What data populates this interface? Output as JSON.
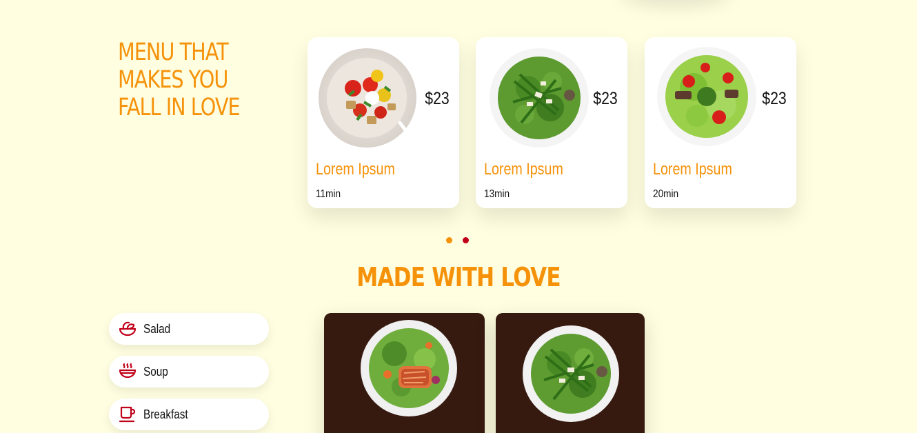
{
  "menu_section": {
    "title": "MENU THAT MAKES YOU FALL IN LOVE",
    "cards": [
      {
        "name": "Lorem Ipsum",
        "price": "$23",
        "time": "11min",
        "image": "tomato-salad-plate"
      },
      {
        "name": "Lorem Ipsum",
        "price": "$23",
        "time": "13min",
        "image": "asparagus-salad-plate"
      },
      {
        "name": "Lorem Ipsum",
        "price": "$23",
        "time": "20min",
        "image": "garden-salad-plate"
      }
    ]
  },
  "carousel": {
    "active_index": 1,
    "count": 2
  },
  "love_section": {
    "title": "MADE WITH LOVE",
    "categories": [
      {
        "label": "Salad",
        "icon": "salad-bowl-icon"
      },
      {
        "label": "Soup",
        "icon": "soup-bowl-icon"
      },
      {
        "label": "Breakfast",
        "icon": "coffee-cup-icon"
      }
    ],
    "dishes": [
      {
        "image": "salmon-salad-plate"
      },
      {
        "image": "asparagus-salad-plate"
      }
    ]
  },
  "colors": {
    "background": "#fffee0",
    "accent": "#f5920a",
    "icon_red": "#c00018",
    "dish_card": "#361a10"
  }
}
